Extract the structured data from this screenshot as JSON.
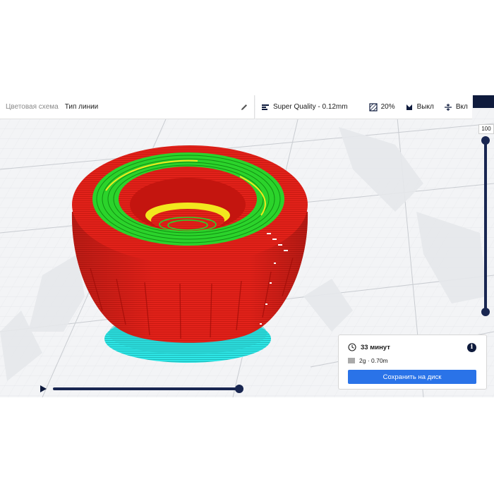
{
  "header": {
    "color_scheme_label": "Цветовая схема",
    "color_scheme_value": "Тип линии",
    "profile": "Super Quality - 0.12mm",
    "infill": "20%",
    "support": "Выкл",
    "adhesion": "Вкл"
  },
  "layer_slider": {
    "label": "100"
  },
  "print_info": {
    "time": "33 минут",
    "material": "2g · 0.70m",
    "save_button": "Сохранить на диск"
  },
  "colors": {
    "accent": "#192651",
    "button": "#2a73e8",
    "wall_outer": "#e3221a",
    "wall_inner": "#2bd32b",
    "skin": "#f2e81e",
    "skirt": "#2ee6e6"
  },
  "icons": {
    "profile": "profile-icon",
    "infill": "infill-icon",
    "support": "support-icon",
    "adhesion": "adhesion-icon",
    "edit": "pencil-icon",
    "time": "clock-icon",
    "material": "spool-icon",
    "info": "info-icon",
    "play": "play-icon"
  }
}
